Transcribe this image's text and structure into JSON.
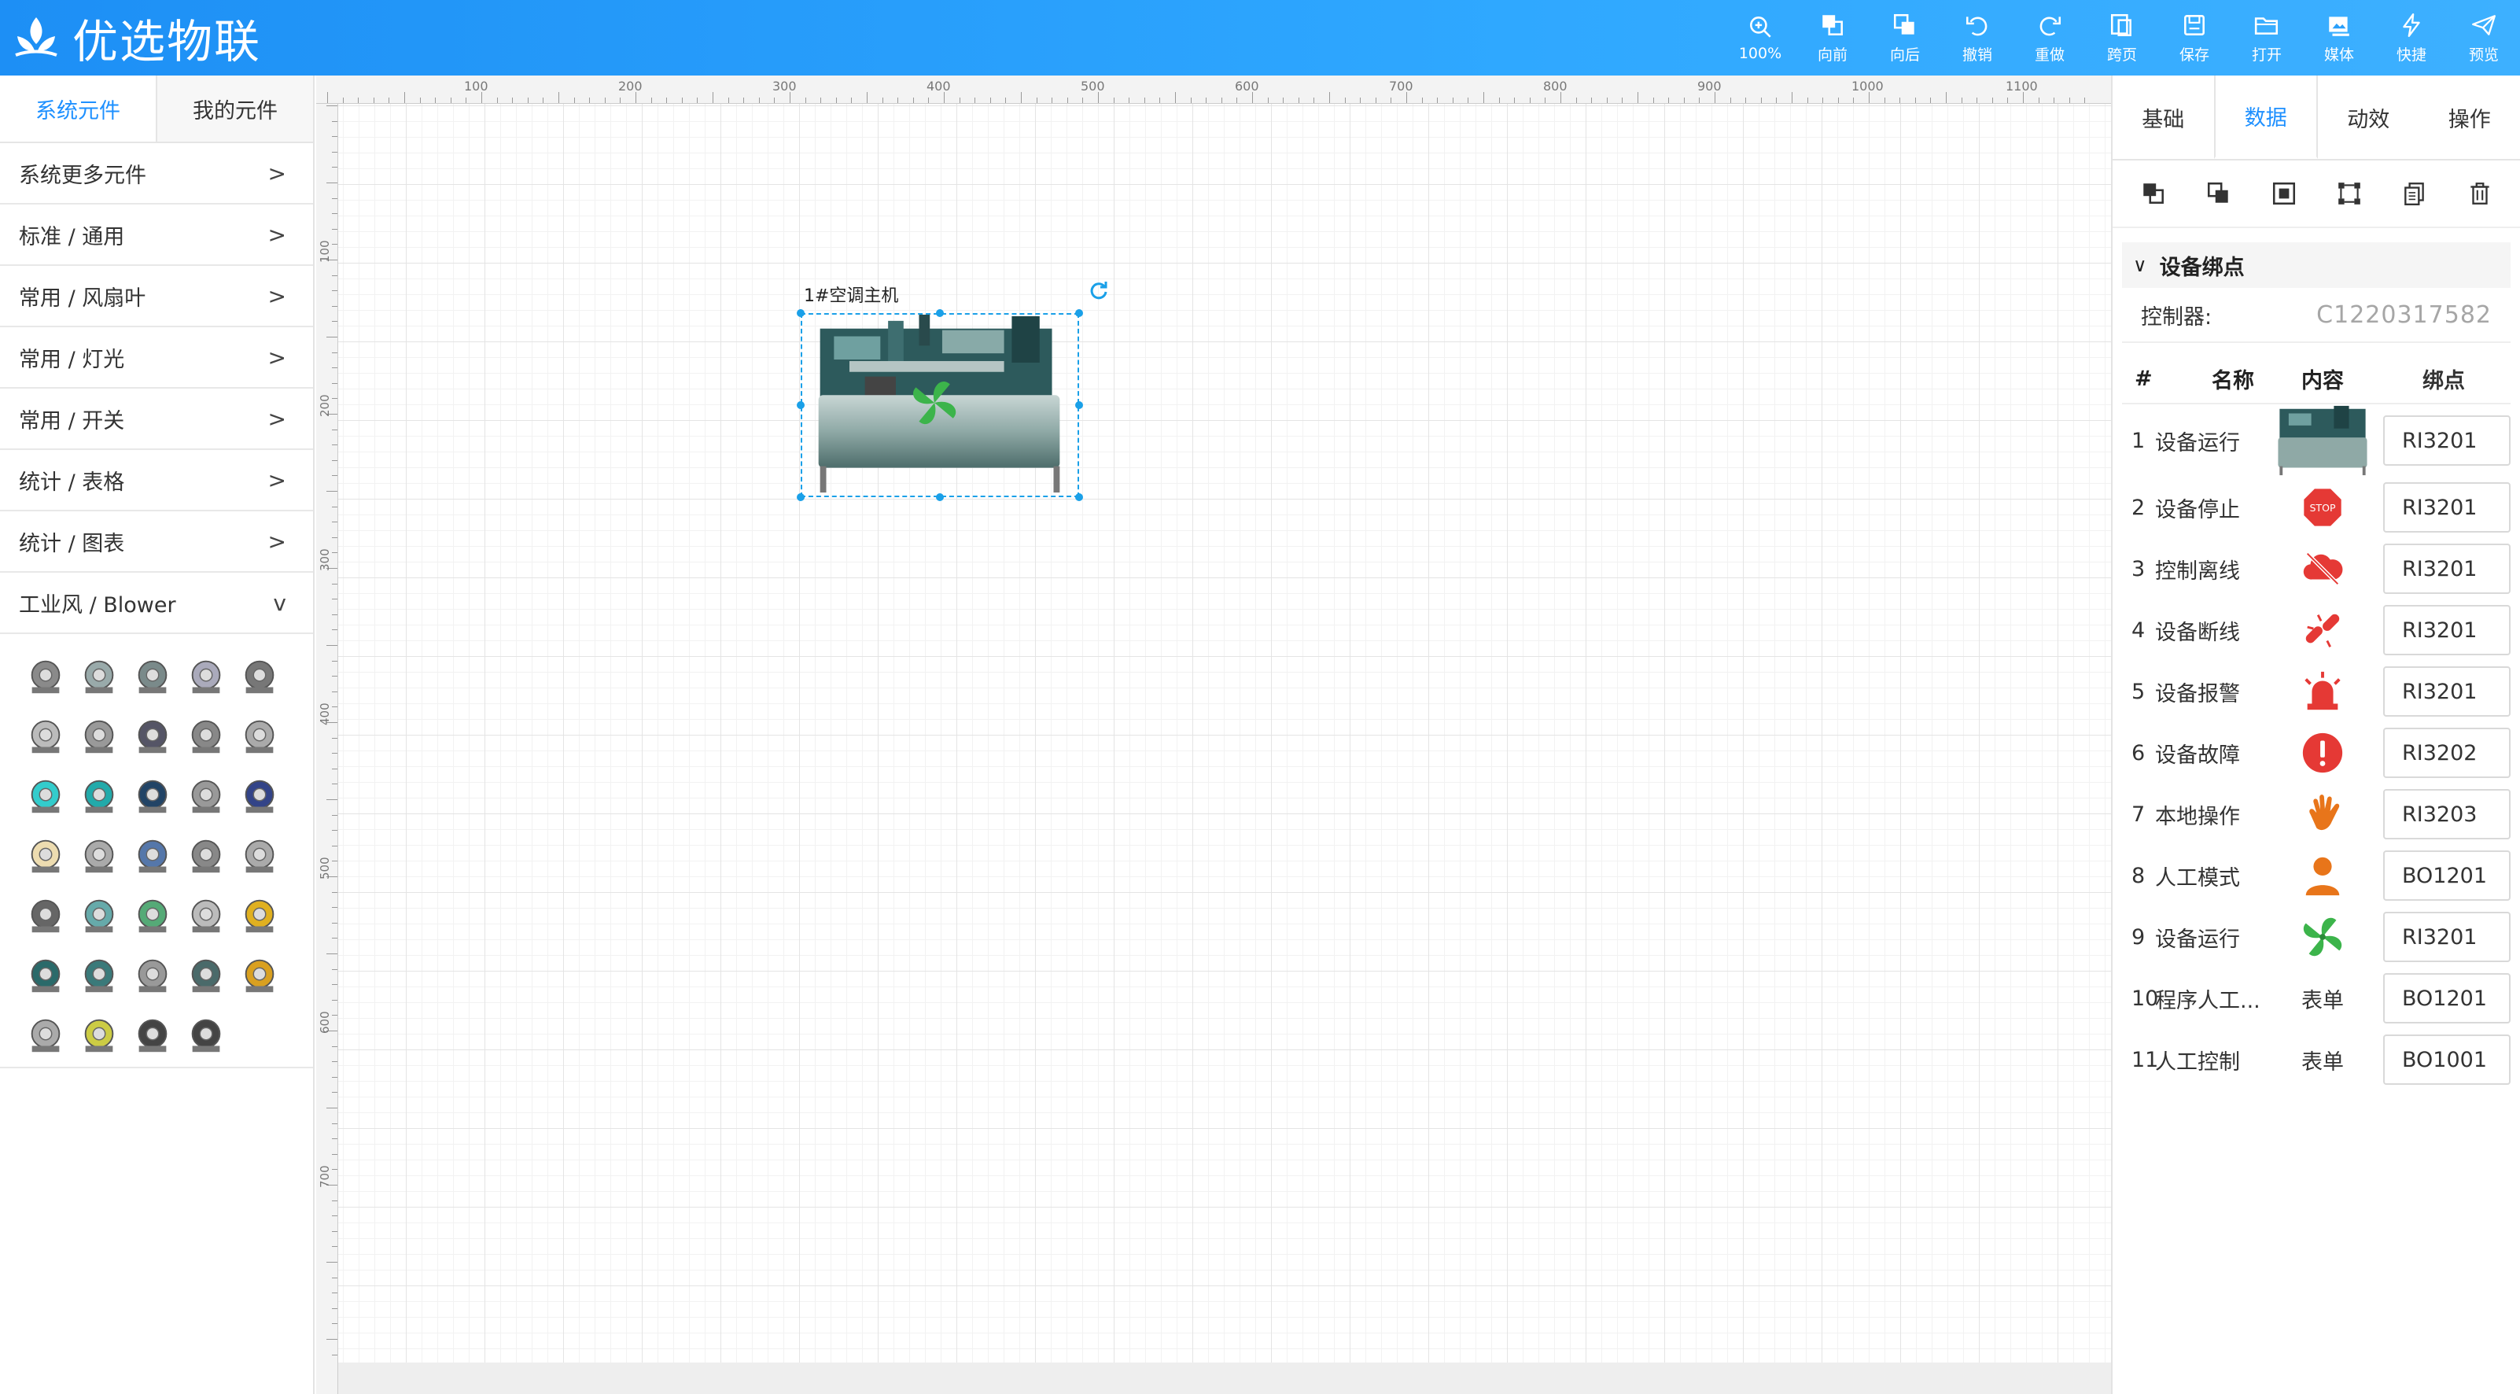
{
  "app": {
    "title": "优选物联"
  },
  "toolbar": [
    {
      "label": "100%",
      "icon": "zoom-in-icon"
    },
    {
      "label": "向前",
      "icon": "bring-forward-icon"
    },
    {
      "label": "向后",
      "icon": "send-backward-icon"
    },
    {
      "label": "撤销",
      "icon": "undo-icon"
    },
    {
      "label": "重做",
      "icon": "redo-icon"
    },
    {
      "label": "跨页",
      "icon": "cross-page-icon"
    },
    {
      "label": "保存",
      "icon": "save-icon"
    },
    {
      "label": "打开",
      "icon": "folder-open-icon"
    },
    {
      "label": "媒体",
      "icon": "media-icon"
    },
    {
      "label": "快捷",
      "icon": "lightning-icon"
    },
    {
      "label": "预览",
      "icon": "send-icon"
    }
  ],
  "left_panel": {
    "tabs": [
      "系统元件",
      "我的元件"
    ],
    "categories": [
      {
        "label": "系统更多元件",
        "chevron": ">"
      },
      {
        "label": "标准 / 通用",
        "chevron": ">"
      },
      {
        "label": "常用 / 风扇叶",
        "chevron": ">"
      },
      {
        "label": "常用 / 灯光",
        "chevron": ">"
      },
      {
        "label": "常用 / 开关",
        "chevron": ">"
      },
      {
        "label": "统计 / 表格",
        "chevron": ">"
      },
      {
        "label": "统计 / 图表",
        "chevron": ">"
      },
      {
        "label": "工业风 / Blower",
        "chevron": "v"
      }
    ],
    "palette_icons": [
      "blower-icon",
      "blower-icon",
      "blower-icon",
      "blower-icon",
      "blower-icon",
      "blower-icon",
      "blower-icon",
      "blower-icon",
      "blower-icon",
      "blower-icon",
      "blower-icon",
      "blower-icon",
      "blower-icon",
      "blower-icon",
      "blower-icon",
      "blower-icon",
      "blower-icon",
      "blower-icon",
      "blower-icon",
      "blower-icon",
      "blower-icon",
      "blower-icon",
      "blower-icon",
      "blower-icon",
      "blower-icon",
      "blower-icon",
      "blower-icon",
      "blower-icon",
      "blower-icon",
      "blower-icon",
      "blower-icon",
      "blower-icon",
      "blower-icon",
      "blower-icon"
    ]
  },
  "canvas": {
    "ruler_top": [
      "100",
      "200",
      "300",
      "400",
      "500",
      "600",
      "700",
      "800",
      "900",
      "1000",
      "1100"
    ],
    "ruler_left": [
      "100",
      "200",
      "300",
      "400",
      "500",
      "600",
      "700"
    ],
    "device_label": "1#空调主机"
  },
  "right_panel": {
    "tabs": [
      "基础",
      "数据",
      "动效",
      "操作"
    ],
    "tool_icons": [
      "bring-forward-icon",
      "send-backward-icon",
      "align-center-icon",
      "distribute-icon",
      "copy-icon",
      "trash-icon"
    ],
    "binding": {
      "section_title": "设备绑点",
      "controller_label": "控制器:",
      "controller_value": "C1220317582",
      "headers": {
        "idx": "#",
        "name": "名称",
        "content": "内容",
        "bind": "绑点"
      },
      "rows": [
        {
          "idx": "1",
          "name": "设备运行",
          "content_icon": "chiller-icon",
          "content_text": "",
          "bind": "RI3201"
        },
        {
          "idx": "2",
          "name": "设备停止",
          "content_icon": "stop-sign-icon",
          "content_text": "",
          "bind": "RI3201"
        },
        {
          "idx": "3",
          "name": "控制离线",
          "content_icon": "cloud-off-icon",
          "content_text": "",
          "bind": "RI3201"
        },
        {
          "idx": "4",
          "name": "设备断线",
          "content_icon": "broken-link-icon",
          "content_text": "",
          "bind": "RI3201"
        },
        {
          "idx": "5",
          "name": "设备报警",
          "content_icon": "alarm-siren-icon",
          "content_text": "",
          "bind": "RI3201"
        },
        {
          "idx": "6",
          "name": "设备故障",
          "content_icon": "fault-exclamation-icon",
          "content_text": "",
          "bind": "RI3202"
        },
        {
          "idx": "7",
          "name": "本地操作",
          "content_icon": "hand-icon",
          "content_text": "",
          "bind": "RI3203"
        },
        {
          "idx": "8",
          "name": "人工模式",
          "content_icon": "person-icon",
          "content_text": "",
          "bind": "BO1201"
        },
        {
          "idx": "9",
          "name": "设备运行",
          "content_icon": "fan-blade-icon",
          "content_text": "",
          "bind": "RI3201"
        },
        {
          "idx": "10",
          "name": "程序人工...",
          "content_icon": "",
          "content_text": "表单",
          "bind": "BO1201"
        },
        {
          "idx": "11",
          "name": "人工控制",
          "content_icon": "",
          "content_text": "表单",
          "bind": "BO1001"
        }
      ]
    }
  },
  "colors": {
    "header": "#2aa0fb",
    "accent": "#1e90ff",
    "stop": "#e53935",
    "alarm": "#e53935",
    "hand": "#e8751a",
    "person": "#e8751a",
    "fan": "#3cb44b"
  }
}
